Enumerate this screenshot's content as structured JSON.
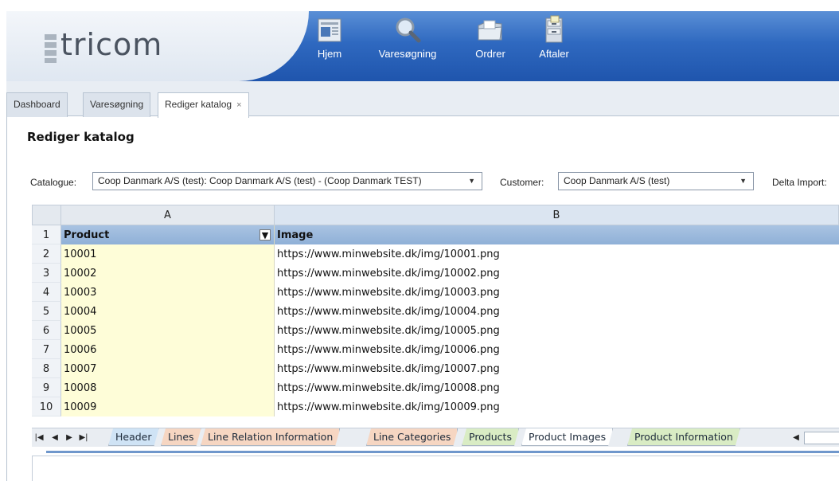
{
  "brand": {
    "logo_text": "tricom"
  },
  "nav": [
    {
      "label": "Hjem",
      "icon": "home-document-icon"
    },
    {
      "label": "Varesøgning",
      "icon": "magnifier-icon"
    },
    {
      "label": "Ordrer",
      "icon": "folder-icon"
    },
    {
      "label": "Aftaler",
      "icon": "file-cabinet-icon"
    }
  ],
  "tabs": [
    {
      "label": "Dashboard"
    },
    {
      "label": "Varesøgning"
    },
    {
      "label": "Rediger katalog",
      "close": "×",
      "active": true
    }
  ],
  "page": {
    "title": "Rediger katalog",
    "catalogue_label": "Catalogue:",
    "catalogue_value": "Coop Danmark A/S (test): Coop Danmark A/S (test) - (Coop Danmark TEST)",
    "customer_label": "Customer:",
    "customer_value": "Coop Danmark A/S (test)",
    "delta_label": "Delta Import:"
  },
  "sheet": {
    "columns": [
      "A",
      "B"
    ],
    "header": {
      "row_num": "1",
      "a": "Product",
      "b": "Image"
    },
    "rows": [
      {
        "num": "2",
        "a": "10001",
        "b": "https://www.minwebsite.dk/img/10001.png"
      },
      {
        "num": "3",
        "a": "10002",
        "b": "https://www.minwebsite.dk/img/10002.png"
      },
      {
        "num": "4",
        "a": "10003",
        "b": "https://www.minwebsite.dk/img/10003.png"
      },
      {
        "num": "5",
        "a": "10004",
        "b": "https://www.minwebsite.dk/img/10004.png"
      },
      {
        "num": "6",
        "a": "10005",
        "b": "https://www.minwebsite.dk/img/10005.png"
      },
      {
        "num": "7",
        "a": "10006",
        "b": "https://www.minwebsite.dk/img/10006.png"
      },
      {
        "num": "8",
        "a": "10007",
        "b": "https://www.minwebsite.dk/img/10007.png"
      },
      {
        "num": "9",
        "a": "10008",
        "b": "https://www.minwebsite.dk/img/10008.png"
      },
      {
        "num": "10",
        "a": "10009",
        "b": "https://www.minwebsite.dk/img/10009.png"
      }
    ],
    "sheet_tabs": [
      {
        "label": "Header",
        "color": "#cfe3f5"
      },
      {
        "label": "Lines",
        "color": "#f6d6c2"
      },
      {
        "label": "Line Relation Information",
        "color": "#f6d6c2"
      },
      {
        "label": "Line Categories",
        "color": "#f6d6c2"
      },
      {
        "label": "Products",
        "color": "#d9ecc4"
      },
      {
        "label": "Product Images",
        "color": "#ffffff",
        "active": true
      },
      {
        "label": "Product Information",
        "color": "#d9ecc4"
      }
    ]
  },
  "colors": {
    "header_blue": "#1f55ad",
    "cell_yellow": "#fefdd8",
    "header_row_blue": "#9bb8dc"
  }
}
